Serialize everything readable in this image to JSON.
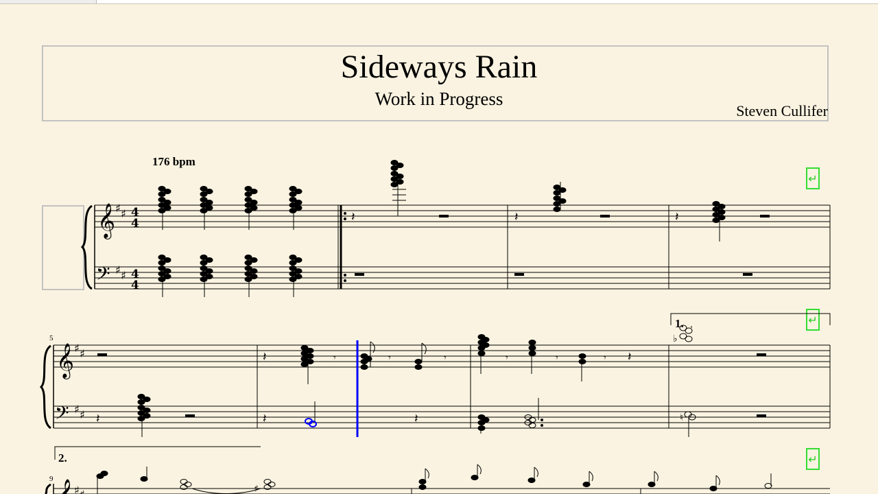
{
  "score": {
    "title": "Sideways Rain",
    "subtitle": "Work in Progress",
    "composer": "Steven Cullifer",
    "tempo": "176 bpm",
    "time_signature": "4/4",
    "key_signature": "D major (2 sharps)"
  },
  "systems": [
    {
      "first_measure": "",
      "volta": ""
    },
    {
      "first_measure": "5",
      "volta": "1."
    },
    {
      "first_measure": "9",
      "volta": "2."
    }
  ],
  "icons": {
    "line_break": "line-break-icon",
    "line_break_glyph": "↵"
  },
  "colors": {
    "background": "#faf3e1",
    "selection": "#0000ff",
    "line_break": "#33dd33"
  }
}
